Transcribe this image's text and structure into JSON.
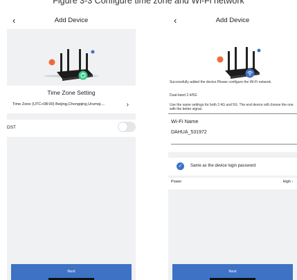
{
  "caption": "Figure 3-3 Configure time zone and Wi-Fi network",
  "colors": {
    "accent": "#3d72c5",
    "dot_orange": "#ef6a3a",
    "dot_blue": "#3d72c5",
    "green": "#36c98a"
  },
  "left": {
    "title": "Add Device",
    "tz_title": "Time Zone Setting",
    "tz_value": "Time Zone (UTC+08:00) Beijing,Chongqing,Urumqi,...",
    "dst_label": "DST",
    "next_label": "Next"
  },
  "right": {
    "title": "Add Device",
    "info1": "Successfully added the device.Please configure the Wi-Fi network.",
    "info2": "Dual-band 2.4/5G",
    "info3": "Use the same settings for both 2.4G and 5G. The end device will choose the one with the better signal.",
    "wifi_label": "Wi-Fi Name",
    "wifi_value": "DAHUA_531972",
    "same_label": "Same as the device login password",
    "power_label": "Power",
    "power_value": "High",
    "next_label": "Next"
  }
}
